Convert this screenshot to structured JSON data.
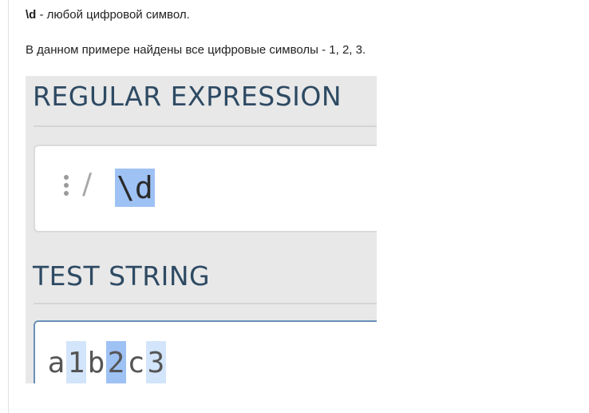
{
  "intro": {
    "term": "\\d",
    "term_description": " - любой цифровой символ.",
    "example_text": "В данном примере найдены все цифровые символы - 1, 2, 3."
  },
  "screenshot": {
    "regex_section_title": "REGULAR EXPRESSION",
    "regex_delimiter": "/",
    "regex_value": "\\d",
    "test_section_title": "TEST STRING",
    "test_string_chars": [
      {
        "char": "a",
        "match": "none"
      },
      {
        "char": "1",
        "match": "light"
      },
      {
        "char": "b",
        "match": "none"
      },
      {
        "char": "2",
        "match": "strong"
      },
      {
        "char": "c",
        "match": "none"
      },
      {
        "char": "3",
        "match": "light"
      }
    ]
  },
  "colors": {
    "section_title": "#2e4a63",
    "match_strong": "#9fc2f5",
    "match_light": "#d3e5fb",
    "test_box_border": "#6a8fb8"
  },
  "icons": {
    "regex_menu": "vertical-dots-icon"
  }
}
